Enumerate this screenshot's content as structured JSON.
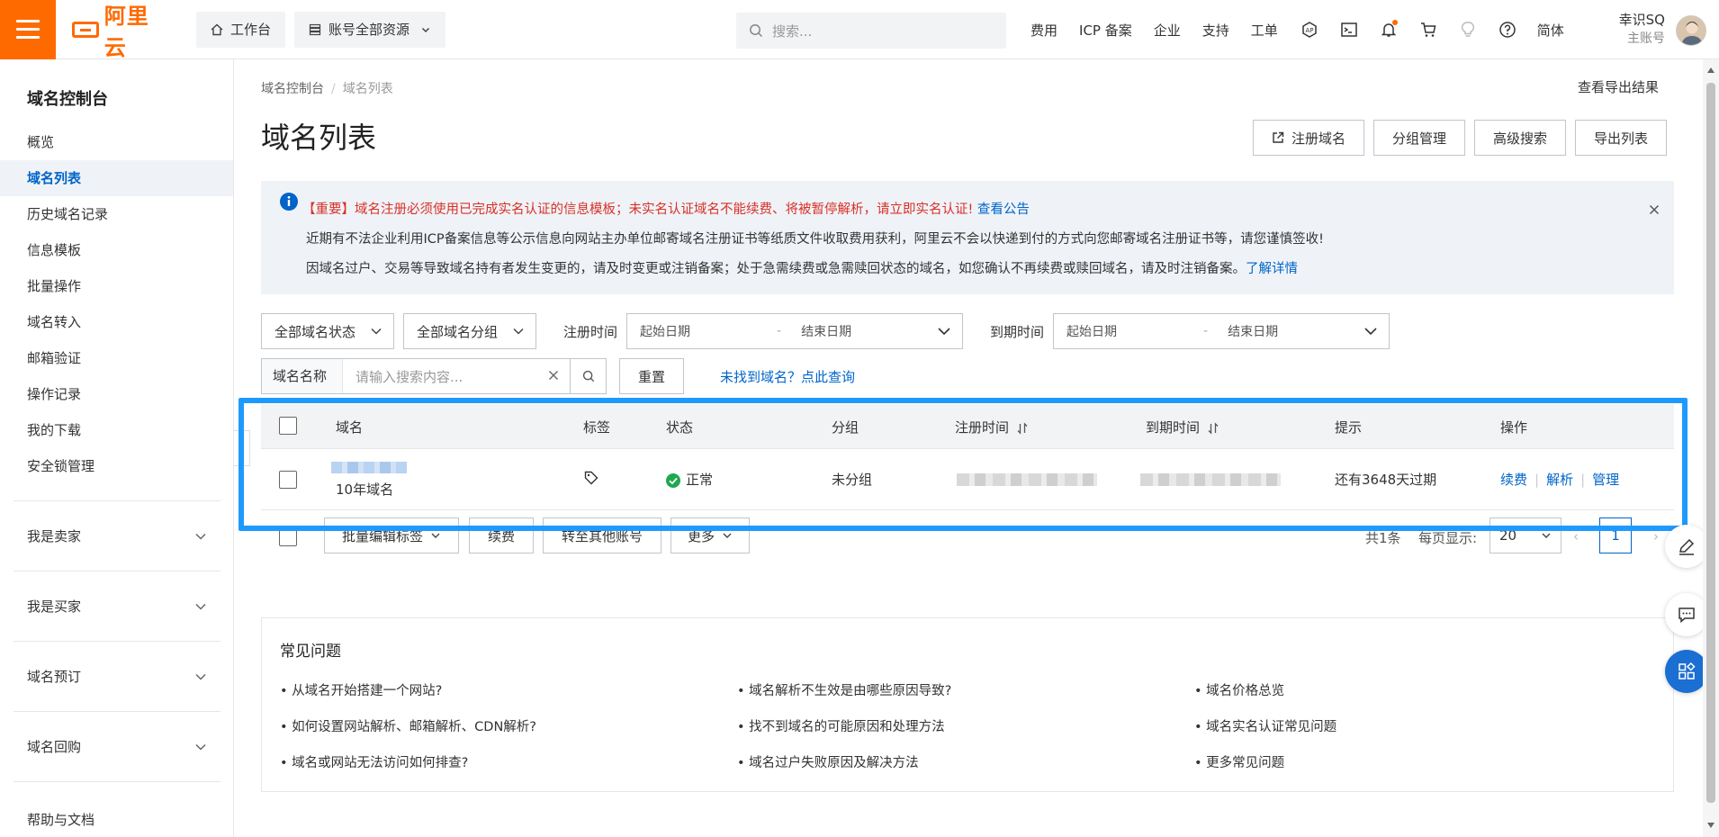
{
  "topbar": {
    "logo_text": "阿里云",
    "workbench": "工作台",
    "resources": "账号全部资源",
    "search_placeholder": "搜索...",
    "links": [
      "费用",
      "ICP 备案",
      "企业",
      "支持",
      "工单"
    ],
    "lang": "简体",
    "user_name": "幸识SQ",
    "user_type": "主账号"
  },
  "sidebar": {
    "title": "域名控制台",
    "items": [
      "概览",
      "域名列表",
      "历史域名记录",
      "信息模板",
      "批量操作",
      "域名转入",
      "邮箱验证",
      "操作记录",
      "我的下载",
      "安全锁管理"
    ],
    "groups": [
      "我是卖家",
      "我是买家",
      "域名预订",
      "域名回购"
    ],
    "footer": "帮助与文档"
  },
  "breadcrumb": [
    "域名控制台",
    "域名列表"
  ],
  "export_result": "查看导出结果",
  "page_title": "域名列表",
  "actions": [
    "注册域名",
    "分组管理",
    "高级搜索",
    "导出列表"
  ],
  "notice": {
    "important": "【重要】域名注册必须使用已完成实名认证的信息模板；未实名认证域名不能续费、将被暂停解析，请立即实名认证!",
    "important_link": "查看公告",
    "line2": "近期有不法企业利用ICP备案信息等公示信息向网站主办单位邮寄域名注册证书等纸质文件收取费用获利，阿里云不会以快递到付的方式向您邮寄域名注册证书等，请您谨慎签收!",
    "line3": "因域名过户、交易等导致域名持有者发生变更的，请及时变更或注销备案；处于急需续费或急需赎回状态的域名，如您确认不再续费或赎回域名，请及时注销备案。",
    "line3_link": "了解详情"
  },
  "filters": {
    "status": "全部域名状态",
    "group": "全部域名分组",
    "reg_label": "注册时间",
    "exp_label": "到期时间",
    "start_placeholder": "起始日期",
    "end_placeholder": "结束日期",
    "search_label": "域名名称",
    "search_placeholder": "请输入搜索内容...",
    "reset": "重置",
    "notfound": "未找到域名？点此查询"
  },
  "table": {
    "headers": [
      "域名",
      "标签",
      "状态",
      "分组",
      "注册时间",
      "到期时间",
      "提示",
      "操作"
    ],
    "rows": [
      {
        "domain_sub": "10年域名",
        "status": "正常",
        "group": "未分组",
        "hint": "还有3648天过期",
        "ops": [
          "续费",
          "解析",
          "管理"
        ]
      }
    ]
  },
  "bulk": {
    "buttons": [
      "批量编辑标签",
      "续费",
      "转至其他账号",
      "更多"
    ],
    "total": "共1条",
    "per_page_label": "每页显示:",
    "per_page": "20",
    "page": "1"
  },
  "faq": {
    "title": "常见问题",
    "items": [
      "从域名开始搭建一个网站?",
      "域名解析不生效是由哪些原因导致?",
      "域名价格总览",
      "如何设置网站解析、邮箱解析、CDN解析?",
      "找不到域名的可能原因和处理方法",
      "域名实名认证常见问题",
      "域名或网站无法访问如何排查?",
      "域名过户失败原因及解决方法",
      "更多常见问题"
    ]
  },
  "colors": {
    "brand": "#ff6a00",
    "link": "#0064c8",
    "highlight": "#1e9aff",
    "success": "#1ea950",
    "danger": "#d93026"
  }
}
